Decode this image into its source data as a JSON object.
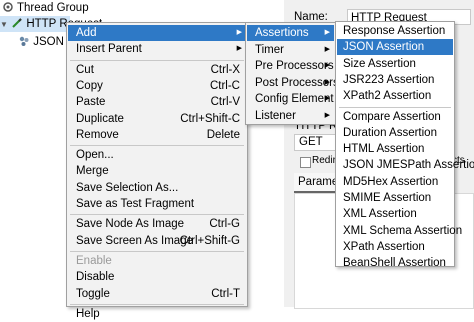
{
  "tree": {
    "thread_group": "Thread Group",
    "http_request": "HTTP Request",
    "json_node": "JSON N"
  },
  "right_panel": {
    "name_label": "Name:",
    "name_value": "HTTP Request",
    "http_request_label": "HTTP Reque",
    "method_value": "GET",
    "redirect_label": "Redire",
    "content_type_label": "cts",
    "params_tab": "Paramet"
  },
  "context_menu": {
    "items": [
      {
        "label": "Add",
        "shortcut": "",
        "submenu": true,
        "highlighted": true
      },
      {
        "label": "Insert Parent",
        "shortcut": "",
        "submenu": true
      },
      {
        "separator": true
      },
      {
        "label": "Cut",
        "shortcut": "Ctrl-X"
      },
      {
        "label": "Copy",
        "shortcut": "Ctrl-C"
      },
      {
        "label": "Paste",
        "shortcut": "Ctrl-V"
      },
      {
        "label": "Duplicate",
        "shortcut": "Ctrl+Shift-C"
      },
      {
        "label": "Remove",
        "shortcut": "Delete"
      },
      {
        "separator": true
      },
      {
        "label": "Open...",
        "shortcut": ""
      },
      {
        "label": "Merge",
        "shortcut": ""
      },
      {
        "label": "Save Selection As...",
        "shortcut": ""
      },
      {
        "label": "Save as Test Fragment",
        "shortcut": ""
      },
      {
        "separator": true
      },
      {
        "label": "Save Node As Image",
        "shortcut": "Ctrl-G"
      },
      {
        "label": "Save Screen As Image",
        "shortcut": "Ctrl+Shift-G"
      },
      {
        "separator": true
      },
      {
        "label": "Enable",
        "shortcut": "",
        "disabled": true
      },
      {
        "label": "Disable",
        "shortcut": ""
      },
      {
        "label": "Toggle",
        "shortcut": "Ctrl-T"
      },
      {
        "separator": true
      },
      {
        "label": "Help",
        "shortcut": ""
      }
    ]
  },
  "add_menu": {
    "items": [
      {
        "label": "Assertions",
        "submenu": true,
        "highlighted": true
      },
      {
        "label": "Timer",
        "submenu": true
      },
      {
        "label": "Pre Processors",
        "submenu": true
      },
      {
        "label": "Post Processors",
        "submenu": true
      },
      {
        "label": "Config Element",
        "submenu": true
      },
      {
        "label": "Listener",
        "submenu": true
      }
    ]
  },
  "assertions_menu": {
    "items": [
      {
        "label": "Response Assertion"
      },
      {
        "label": "JSON Assertion",
        "highlighted": true
      },
      {
        "label": "Size Assertion"
      },
      {
        "label": "JSR223 Assertion"
      },
      {
        "label": "XPath2 Assertion"
      },
      {
        "separator": true
      },
      {
        "label": "Compare Assertion"
      },
      {
        "label": "Duration Assertion"
      },
      {
        "label": "HTML Assertion"
      },
      {
        "label": "JSON JMESPath Assertion"
      },
      {
        "label": "MD5Hex Assertion"
      },
      {
        "label": "SMIME Assertion"
      },
      {
        "label": "XML Assertion"
      },
      {
        "label": "XML Schema Assertion"
      },
      {
        "label": "XPath Assertion"
      },
      {
        "label": "BeanShell Assertion"
      }
    ]
  },
  "colors": {
    "highlight": "#2e79c6",
    "menu_bg": "#f2f2f2",
    "tree_selection": "#cfe4f7"
  }
}
